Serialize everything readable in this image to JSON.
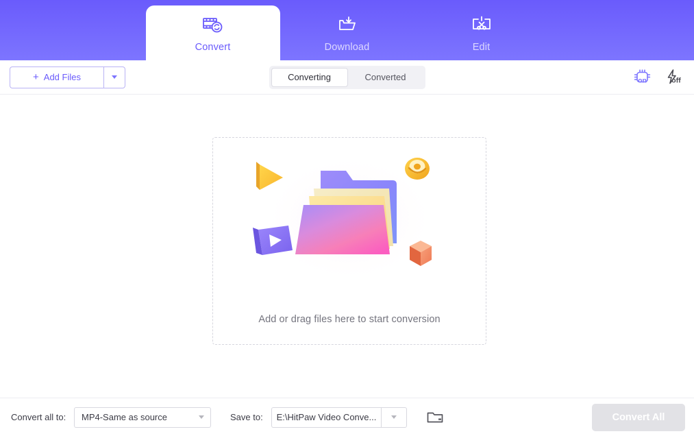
{
  "header": {
    "gradient_top": "#6a5bfc",
    "gradient_bottom": "#7d75ff",
    "tabs": [
      {
        "id": "convert",
        "label": "Convert",
        "icon": "film-refresh-icon",
        "active": true
      },
      {
        "id": "download",
        "label": "Download",
        "icon": "folder-download-icon",
        "active": false
      },
      {
        "id": "edit",
        "label": "Edit",
        "icon": "screen-scissors-icon",
        "active": false
      }
    ]
  },
  "toolbar": {
    "add_files_label": "Add Files",
    "add_files_plus": "+",
    "add_files_caret_icon": "chevron-down-icon",
    "segments": [
      {
        "id": "converting",
        "label": "Converting",
        "active": true
      },
      {
        "id": "converted",
        "label": "Converted",
        "active": false
      }
    ],
    "right_icons": [
      {
        "id": "hardware-acceleration",
        "icon": "chip-icon",
        "state_label": "on",
        "color": "#7d75ff"
      },
      {
        "id": "lossless-turbo",
        "icon": "lightning-icon",
        "state_label": "off",
        "color": "#4a4a52"
      }
    ]
  },
  "main": {
    "dropzone_text": "Add or drag files here to start conversion",
    "illustration": "folder-3d-illustration",
    "border_style": "dashed",
    "border_color": "#d6d6de"
  },
  "bottom_bar": {
    "convert_all_to_label": "Convert all to:",
    "format_value": "MP4-Same as source",
    "format_caret_icon": "chevron-down-icon",
    "save_to_label": "Save to:",
    "save_to_value": "E:\\HitPaw Video Conve...",
    "save_to_caret_icon": "chevron-down-icon",
    "browse_folder_icon": "folder-icon",
    "convert_all_button": "Convert All",
    "convert_all_disabled": true,
    "convert_all_bg": "#e2e2e6"
  },
  "colors": {
    "accent": "#6a5bfc",
    "accent_light": "#7d75ff",
    "text_primary": "#3c3c46",
    "text_muted": "#74747e",
    "background": "#ffffff",
    "separator": "#ececf2"
  }
}
